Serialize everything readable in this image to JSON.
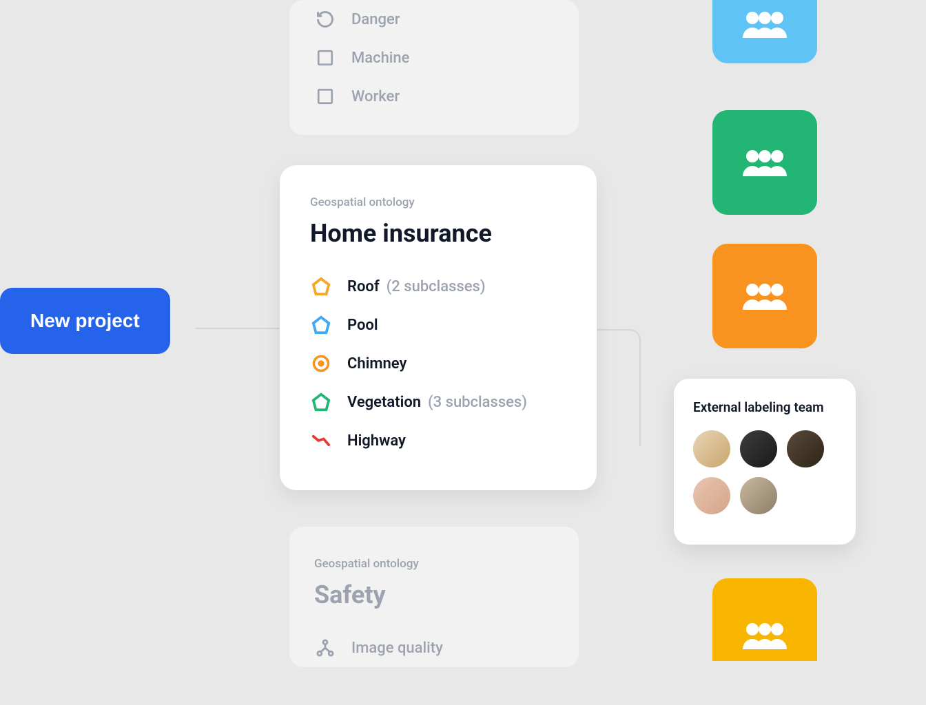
{
  "new_project_label": "New project",
  "top_card": {
    "items": [
      {
        "icon": "cycle",
        "label": "Danger"
      },
      {
        "icon": "checkbox",
        "label": "Machine"
      },
      {
        "icon": "checkbox",
        "label": "Worker"
      }
    ]
  },
  "main_card": {
    "category": "Geospatial ontology",
    "title": "Home insurance",
    "items": [
      {
        "icon": "pentagon-yellow",
        "label": "Roof",
        "sub": "(2 subclasses)"
      },
      {
        "icon": "pentagon-blue",
        "label": "Pool",
        "sub": ""
      },
      {
        "icon": "circle-orange",
        "label": "Chimney",
        "sub": ""
      },
      {
        "icon": "pentagon-green",
        "label": "Vegetation",
        "sub": "(3 subclasses)"
      },
      {
        "icon": "line-red",
        "label": "Highway",
        "sub": ""
      }
    ]
  },
  "bottom_card": {
    "category": "Geospatial ontology",
    "title": "Safety",
    "items": [
      {
        "icon": "hierarchy",
        "label": "Image quality"
      }
    ]
  },
  "external_team": {
    "title": "External labeling team"
  },
  "team_tiles": [
    "blue",
    "green",
    "orange",
    "yellow"
  ]
}
